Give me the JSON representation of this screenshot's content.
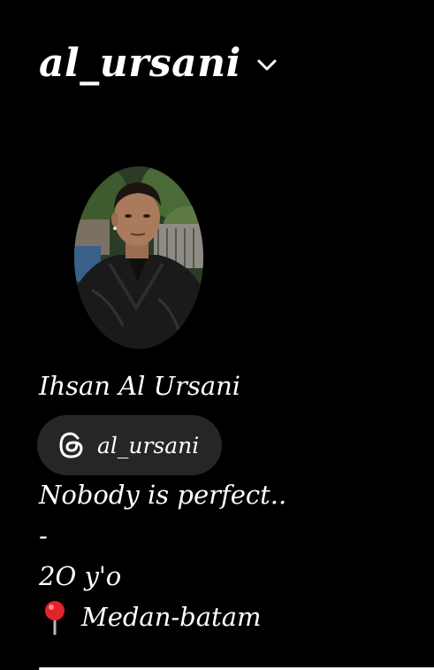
{
  "header": {
    "username": "al_ursani",
    "switch_icon": "chevron-down-icon"
  },
  "profile": {
    "avatar_icon": "profile-photo",
    "full_name": "Ihsan Al Ursani",
    "threads": {
      "icon": "threads-icon",
      "handle": "al_ursani"
    },
    "bio": {
      "line1": "Nobody is perfect..",
      "line2": "-",
      "line3": "2O y'o",
      "location_icon": "red-pin-icon",
      "location": "Medan-batam"
    }
  },
  "colors": {
    "background": "#000000",
    "text": "#ffffff",
    "pill": "#262626",
    "pin": "#e0242b"
  }
}
